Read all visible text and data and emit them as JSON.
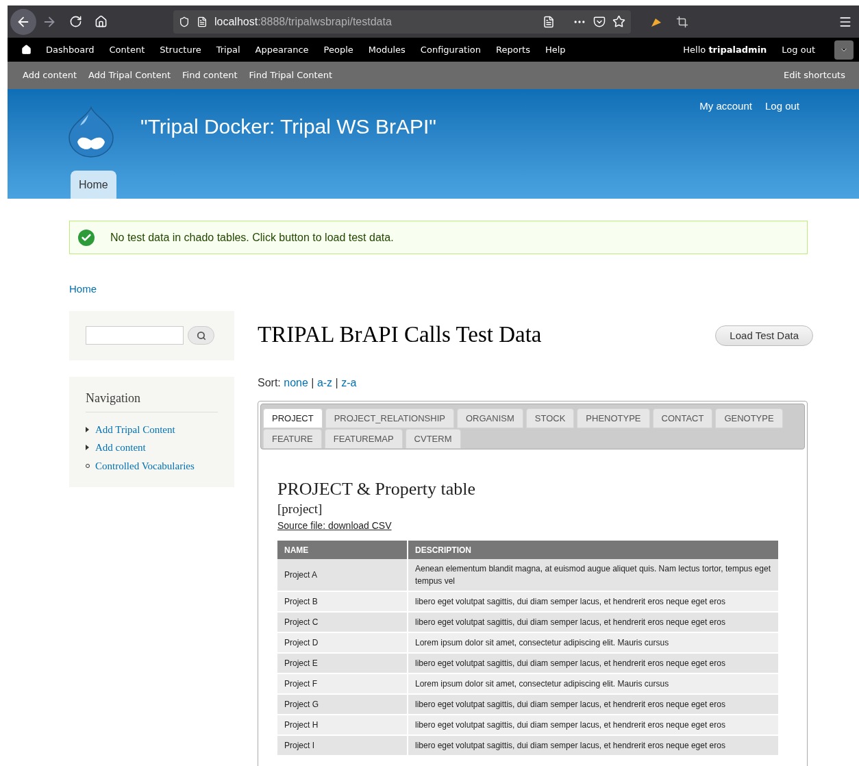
{
  "browser": {
    "url_host": "localhost",
    "url_path": ":8888/tripalwsbrapi/testdata"
  },
  "admin_menu": {
    "items": [
      "Dashboard",
      "Content",
      "Structure",
      "Tripal",
      "Appearance",
      "People",
      "Modules",
      "Configuration",
      "Reports",
      "Help"
    ],
    "greeting": "Hello ",
    "user": "tripaladmin",
    "logout": "Log out"
  },
  "shortcuts": {
    "items": [
      "Add content",
      "Add Tripal Content",
      "Find content",
      "Find Tripal Content"
    ],
    "edit": "Edit shortcuts"
  },
  "header": {
    "site_name": "\"Tripal Docker: Tripal WS BrAPI\"",
    "secondary_links": [
      "My account",
      "Log out"
    ],
    "tabs": [
      {
        "label": "Home",
        "selected": true
      }
    ]
  },
  "message": {
    "text": "No test data in chado tables. Click button to load test data."
  },
  "breadcrumb": "Home",
  "sidebar": {
    "navigation_title": "Navigation",
    "items": [
      {
        "label": "Add Tripal Content",
        "expanded": false
      },
      {
        "label": "Add content",
        "expanded": false
      },
      {
        "label": "Controlled Vocabularies",
        "expanded": true
      }
    ]
  },
  "page": {
    "title": "TRIPAL BrAPI Calls Test Data",
    "load_button": "Load Test Data",
    "sort_label": "Sort: ",
    "sort_links": [
      "none",
      "a-z",
      "z-a"
    ],
    "sort_separator": " | "
  },
  "tabs": [
    {
      "label": "PROJECT",
      "selected": true
    },
    {
      "label": "PROJECT_RELATIONSHIP",
      "selected": false
    },
    {
      "label": "ORGANISM",
      "selected": false
    },
    {
      "label": "STOCK",
      "selected": false
    },
    {
      "label": "PHENOTYPE",
      "selected": false
    },
    {
      "label": "CONTACT",
      "selected": false
    },
    {
      "label": "GENOTYPE",
      "selected": false
    },
    {
      "label": "FEATURE",
      "selected": false
    },
    {
      "label": "FEATUREMAP",
      "selected": false
    },
    {
      "label": "CVTERM",
      "selected": false
    }
  ],
  "panel": {
    "title": "PROJECT & Property table",
    "subtitle": "[project]",
    "source_link": "Source file: download CSV"
  },
  "table": {
    "columns": [
      "NAME",
      "DESCRIPTION"
    ],
    "rows": [
      [
        "Project A",
        "Aenean elementum blandit magna, at euismod augue aliquet quis. Nam lectus tortor, tempus eget tempus vel"
      ],
      [
        "Project B",
        "libero eget volutpat sagittis, dui diam semper lacus, et hendrerit eros neque eget eros"
      ],
      [
        "Project C",
        "libero eget volutpat sagittis, dui diam semper lacus, et hendrerit eros neque eget eros"
      ],
      [
        "Project D",
        "Lorem ipsum dolor sit amet, consectetur adipiscing elit. Mauris cursus"
      ],
      [
        "Project E",
        "libero eget volutpat sagittis, dui diam semper lacus, et hendrerit eros neque eget eros"
      ],
      [
        "Project F",
        "Lorem ipsum dolor sit amet, consectetur adipiscing elit. Mauris cursus"
      ],
      [
        "Project G",
        "libero eget volutpat sagittis, dui diam semper lacus, et hendrerit eros neque eget eros"
      ],
      [
        "Project H",
        "libero eget volutpat sagittis, dui diam semper lacus, et hendrerit eros neque eget eros"
      ],
      [
        "Project I",
        "libero eget volutpat sagittis, dui diam semper lacus, et hendrerit eros neque eget eros"
      ]
    ]
  }
}
